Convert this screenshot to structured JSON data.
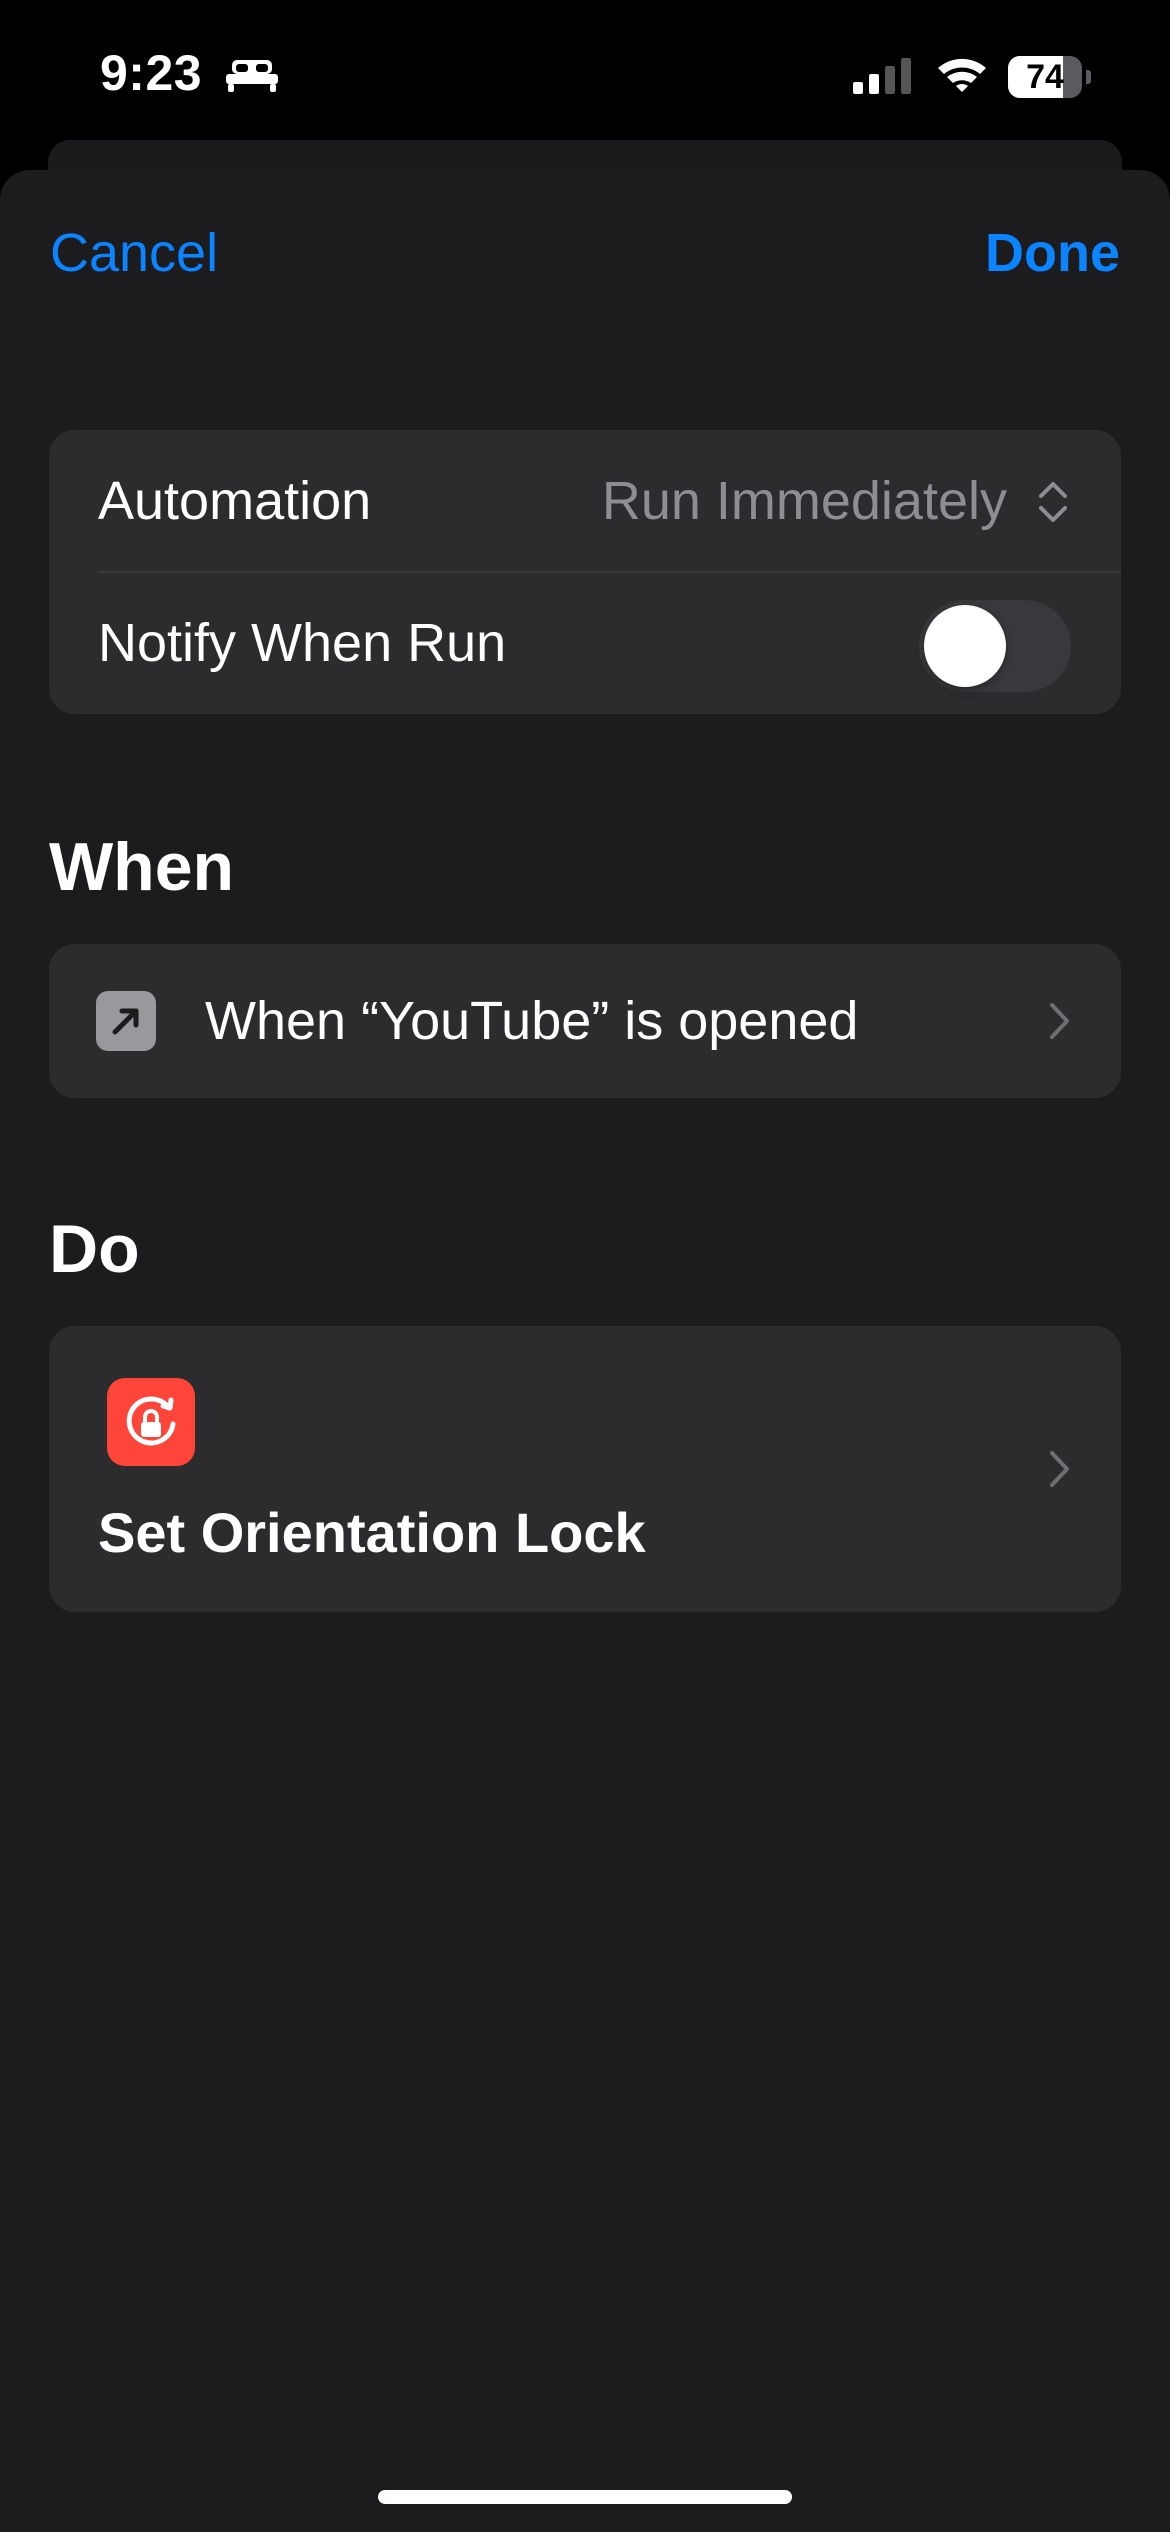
{
  "status_bar": {
    "time": "9:23",
    "battery_level": 74,
    "battery_label": "74",
    "icons": [
      "bed-icon",
      "signal-icon",
      "wifi-icon",
      "battery-icon"
    ]
  },
  "nav": {
    "cancel_label": "Cancel",
    "done_label": "Done"
  },
  "settings": {
    "automation_label": "Automation",
    "automation_value": "Run Immediately",
    "notify_label": "Notify When Run",
    "notify_enabled": false
  },
  "when_section": {
    "title": "When",
    "trigger_label": "When “YouTube” is opened",
    "icon": "app-open-arrow-icon"
  },
  "do_section": {
    "title": "Do",
    "action_label": "Set Orientation Lock",
    "icon": "orientation-lock-icon"
  },
  "colors": {
    "accent": "#0a84ff",
    "background": "#1c1c1e",
    "card": "#2c2c2e",
    "secondary_text": "#8d8d93",
    "action_icon_bg": "#ff453a",
    "trigger_icon_bg": "#98989d"
  }
}
